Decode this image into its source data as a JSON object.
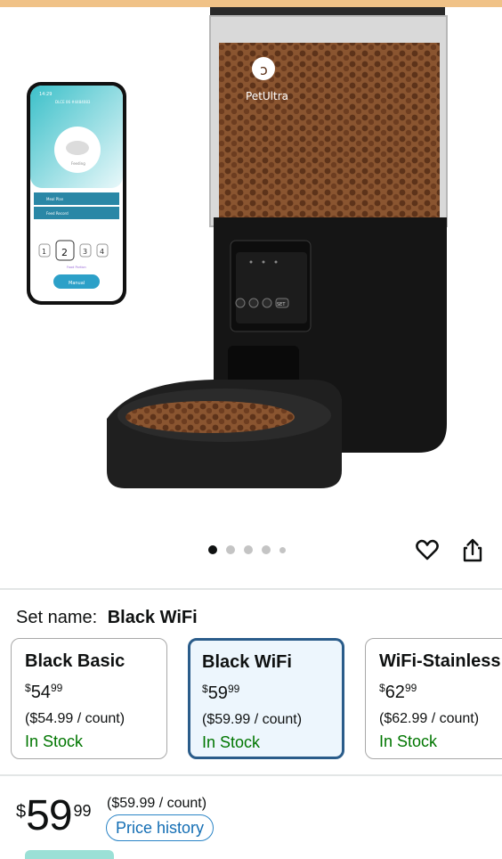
{
  "gallery": {
    "product_image": "PetUltra automatic pet feeder with smartphone app",
    "brand_logo_text": "PetUltra",
    "panel_button_label": "SET",
    "panel_button_label_2": "FEED",
    "dots_total": 5,
    "active_dot_index": 0,
    "phone": {
      "time": "14:29",
      "header": "DLCE 06 #4484083",
      "status": "Feeding",
      "menu_1": "Meal Plan",
      "menu_2": "Feed Record",
      "portions": [
        "1",
        "2",
        "3",
        "4"
      ],
      "portion_caption": "Food Portion",
      "manual_button": "Manual"
    }
  },
  "icons": {
    "favorite": "heart-outline-icon",
    "share": "share-icon"
  },
  "set_name": {
    "label": "Set name:",
    "value": "Black WiFi"
  },
  "variants": [
    {
      "name": "Black Basic",
      "symbol": "$",
      "whole": "54",
      "fraction": "99",
      "unit_price": "($54.99 / count)",
      "stock": "In Stock",
      "selected": false
    },
    {
      "name": "Black WiFi",
      "symbol": "$",
      "whole": "59",
      "fraction": "99",
      "unit_price": "($59.99 / count)",
      "stock": "In Stock",
      "selected": true
    },
    {
      "name": "WiFi-Stainless",
      "symbol": "$",
      "whole": "62",
      "fraction": "99",
      "unit_price": "($62.99 / count)",
      "stock": "In Stock",
      "selected": false
    }
  ],
  "price": {
    "symbol": "$",
    "whole": "59",
    "fraction": "99",
    "unit_price": "($59.99 / count)",
    "history_button": "Price history"
  },
  "colors": {
    "accent_selected": "#2a5c8a",
    "stock_green": "#007600",
    "link_blue": "#146eb4"
  }
}
